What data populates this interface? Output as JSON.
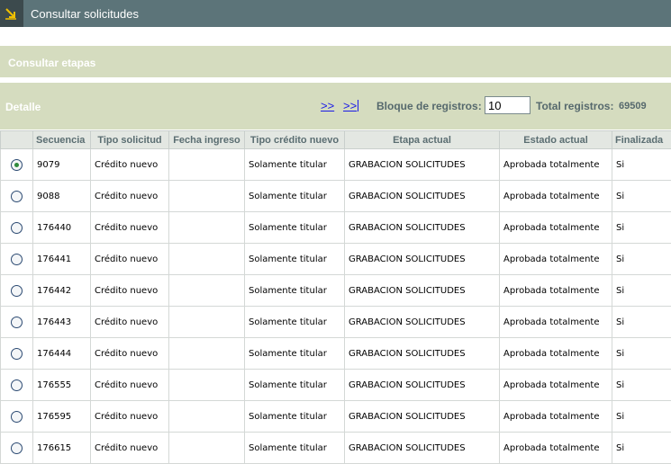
{
  "header": {
    "title": "Consultar solicitudes",
    "icon": "arrow-down-right-icon"
  },
  "section": {
    "title": "Consultar etapas"
  },
  "detail": {
    "label": "Detalle",
    "next_label": ">>",
    "last_label": ">>",
    "block_label": "Bloque de registros:",
    "block_value": "10",
    "total_label": "Total registros:",
    "total_value": "69509"
  },
  "table": {
    "columns": [
      "Secuencia",
      "Tipo solicitud",
      "Fecha ingreso",
      "Tipo crédito nuevo",
      "Etapa actual",
      "Estado actual",
      "Finalizada"
    ],
    "rows": [
      {
        "selected": true,
        "secuencia": "9079",
        "tipo_solicitud": "Crédito nuevo",
        "fecha_ingreso": "",
        "tipo_credito": "Solamente titular",
        "etapa": "GRABACION SOLICITUDES",
        "estado": "Aprobada totalmente",
        "finalizada": "Si"
      },
      {
        "selected": false,
        "secuencia": "9088",
        "tipo_solicitud": "Crédito nuevo",
        "fecha_ingreso": "",
        "tipo_credito": "Solamente titular",
        "etapa": "GRABACION SOLICITUDES",
        "estado": "Aprobada totalmente",
        "finalizada": "Si"
      },
      {
        "selected": false,
        "secuencia": "176440",
        "tipo_solicitud": "Crédito nuevo",
        "fecha_ingreso": "",
        "tipo_credito": "Solamente titular",
        "etapa": "GRABACION SOLICITUDES",
        "estado": "Aprobada totalmente",
        "finalizada": "Si"
      },
      {
        "selected": false,
        "secuencia": "176441",
        "tipo_solicitud": "Crédito nuevo",
        "fecha_ingreso": "",
        "tipo_credito": "Solamente titular",
        "etapa": "GRABACION SOLICITUDES",
        "estado": "Aprobada totalmente",
        "finalizada": "Si"
      },
      {
        "selected": false,
        "secuencia": "176442",
        "tipo_solicitud": "Crédito nuevo",
        "fecha_ingreso": "",
        "tipo_credito": "Solamente titular",
        "etapa": "GRABACION SOLICITUDES",
        "estado": "Aprobada totalmente",
        "finalizada": "Si"
      },
      {
        "selected": false,
        "secuencia": "176443",
        "tipo_solicitud": "Crédito nuevo",
        "fecha_ingreso": "",
        "tipo_credito": "Solamente titular",
        "etapa": "GRABACION SOLICITUDES",
        "estado": "Aprobada totalmente",
        "finalizada": "Si"
      },
      {
        "selected": false,
        "secuencia": "176444",
        "tipo_solicitud": "Crédito nuevo",
        "fecha_ingreso": "",
        "tipo_credito": "Solamente titular",
        "etapa": "GRABACION SOLICITUDES",
        "estado": "Aprobada totalmente",
        "finalizada": "Si"
      },
      {
        "selected": false,
        "secuencia": "176555",
        "tipo_solicitud": "Crédito nuevo",
        "fecha_ingreso": "",
        "tipo_credito": "Solamente titular",
        "etapa": "GRABACION SOLICITUDES",
        "estado": "Aprobada totalmente",
        "finalizada": "Si"
      },
      {
        "selected": false,
        "secuencia": "176595",
        "tipo_solicitud": "Crédito nuevo",
        "fecha_ingreso": "",
        "tipo_credito": "Solamente titular",
        "etapa": "GRABACION SOLICITUDES",
        "estado": "Aprobada totalmente",
        "finalizada": "Si"
      },
      {
        "selected": false,
        "secuencia": "176615",
        "tipo_solicitud": "Crédito nuevo",
        "fecha_ingreso": "",
        "tipo_credito": "Solamente titular",
        "etapa": "GRABACION SOLICITUDES",
        "estado": "Aprobada totalmente",
        "finalizada": "Si"
      }
    ]
  }
}
